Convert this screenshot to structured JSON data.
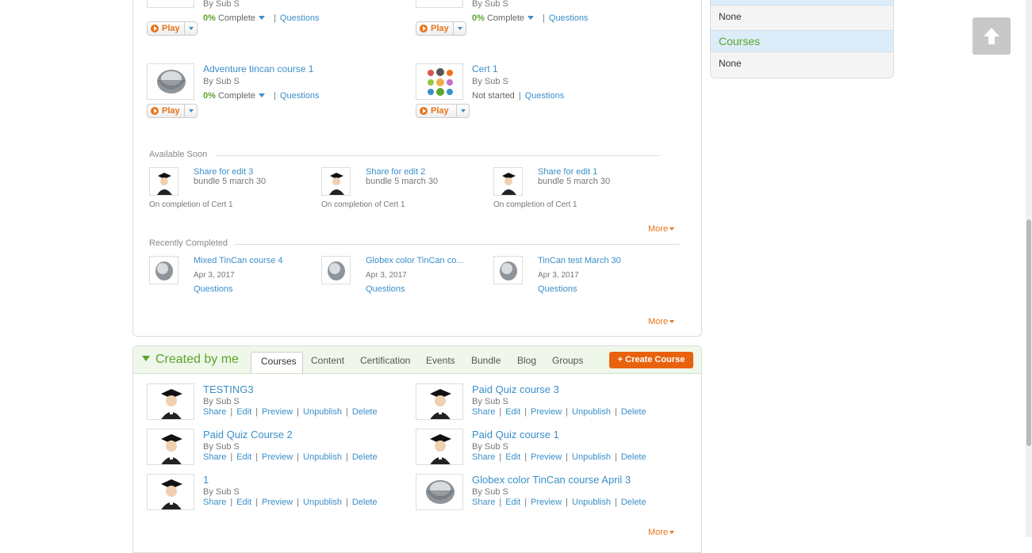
{
  "my_courses": [
    {
      "title": "",
      "by": "By Sub S",
      "percent": "0%",
      "status_word": "Complete",
      "questions": "Questions",
      "play": "Play",
      "thumb": "bucket"
    },
    {
      "title": "",
      "by": "By Sub S",
      "percent": "0%",
      "status_word": "Complete",
      "questions": "Questions",
      "play": "Play",
      "thumb": "bucket"
    },
    {
      "title": "Adventure tincan course 1",
      "by": "By Sub S",
      "percent": "0%",
      "status_word": "Complete",
      "questions": "Questions",
      "play": "Play",
      "thumb": "bucket"
    },
    {
      "title": "Cert 1",
      "by": "By Sub S",
      "status_text": "Not started",
      "questions": "Questions",
      "play": "Play",
      "thumb": "cert"
    }
  ],
  "available_soon": {
    "label": "Available Soon",
    "items": [
      {
        "title": "Share for edit 3",
        "sub": "bundle 5 march 30",
        "foot": "On completion of Cert 1"
      },
      {
        "title": "Share for edit 2",
        "sub": "bundle 5 march 30",
        "foot": "On completion of Cert 1"
      },
      {
        "title": "Share for edit 1",
        "sub": "bundle 5 march 30",
        "foot": "On completion of Cert 1"
      }
    ],
    "more": "More"
  },
  "recently_completed": {
    "label": "Recently Completed",
    "items": [
      {
        "title": "Mixed TinCan course 4",
        "date": "Apr 3, 2017",
        "questions": "Questions"
      },
      {
        "title": "Globex color TinCan co...",
        "date": "Apr 3, 2017",
        "questions": "Questions"
      },
      {
        "title": "TinCan test March 30",
        "date": "Apr 3, 2017",
        "questions": "Questions"
      }
    ],
    "more": "More"
  },
  "created_by_me": {
    "title": "Created by me",
    "tabs": [
      "Courses",
      "Content",
      "Certification",
      "Events",
      "Bundle",
      "Blog",
      "Groups"
    ],
    "create_button": "+ Create Course",
    "courses": [
      {
        "title": "TESTING3",
        "by": "By Sub S",
        "thumb": "grad"
      },
      {
        "title": "Paid Quiz course 3",
        "by": "By Sub S",
        "thumb": "grad"
      },
      {
        "title": "Paid Quiz Course 2",
        "by": "By Sub S",
        "thumb": "grad"
      },
      {
        "title": "Paid Quiz course 1",
        "by": "By Sub S",
        "thumb": "grad"
      },
      {
        "title": "1",
        "by": "By Sub S",
        "thumb": "grad"
      },
      {
        "title": "Globex color TinCan course April 3",
        "by": "By Sub S",
        "thumb": "bucket"
      }
    ],
    "actions": [
      "Share",
      "Edit",
      "Preview",
      "Unpublish",
      "Delete"
    ],
    "more": "More"
  },
  "right_panel": {
    "none_top": "None",
    "courses_heading": "Courses",
    "none_bottom": "None"
  },
  "colors": {
    "accent": "#e8741a",
    "link": "#3a8fc8",
    "green": "#5aa52a"
  }
}
